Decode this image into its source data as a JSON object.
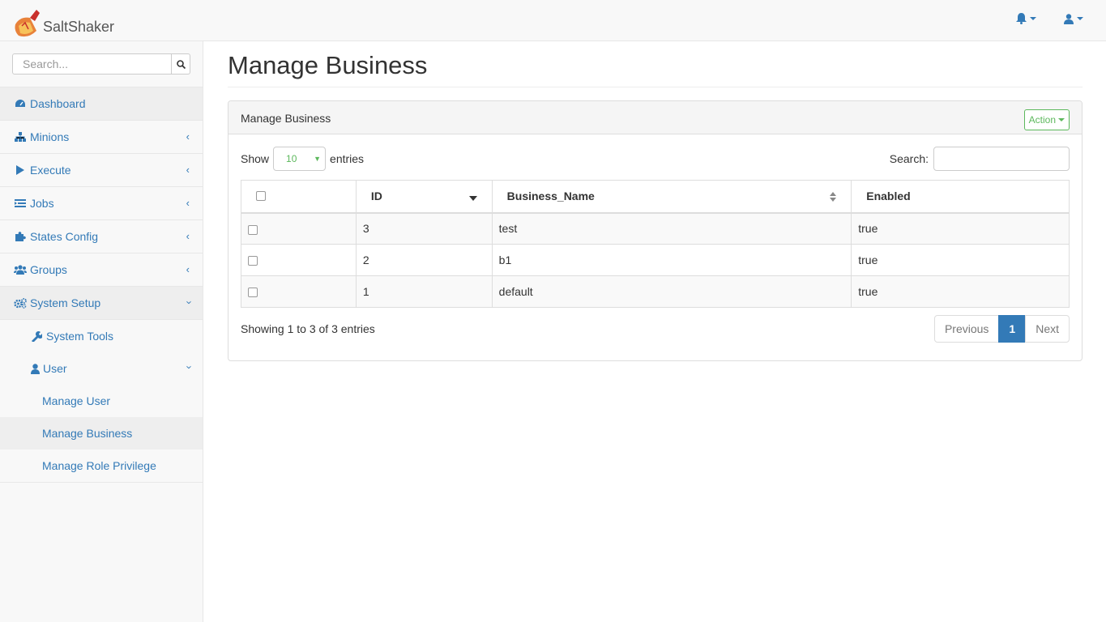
{
  "app": {
    "name": "SaltShaker"
  },
  "navbar": {
    "bell_icon": "bell-icon",
    "user_icon": "user-icon"
  },
  "sidebar": {
    "search_placeholder": "Search...",
    "items": [
      {
        "label": "Dashboard",
        "icon": "dashboard-icon"
      },
      {
        "label": "Minions",
        "icon": "sitemap-icon"
      },
      {
        "label": "Execute",
        "icon": "play-icon"
      },
      {
        "label": "Jobs",
        "icon": "list-icon"
      },
      {
        "label": "States Config",
        "icon": "puzzle-icon"
      },
      {
        "label": "Groups",
        "icon": "users-icon"
      },
      {
        "label": "System Setup",
        "icon": "gears-icon"
      }
    ],
    "system_tools": "System Tools",
    "user": "User",
    "user_children": [
      "Manage User",
      "Manage Business",
      "Manage Role Privilege"
    ]
  },
  "page": {
    "title": "Manage Business"
  },
  "panel": {
    "heading": "Manage Business",
    "action_label": "Action",
    "show_label": "Show",
    "length_value": "10",
    "entries_label": "entries",
    "search_label": "Search:",
    "columns": [
      "",
      "ID",
      "Business_Name",
      "Enabled"
    ],
    "rows": [
      {
        "id": "3",
        "name": "test",
        "enabled": "true"
      },
      {
        "id": "2",
        "name": "b1",
        "enabled": "true"
      },
      {
        "id": "1",
        "name": "default",
        "enabled": "true"
      }
    ],
    "info": "Showing 1 to 3 of 3 entries",
    "pagination": {
      "previous": "Previous",
      "current": "1",
      "next": "Next"
    }
  },
  "colors": {
    "link": "#337ab7",
    "accent_green": "#5cb85c",
    "active_bg": "#eeeeee"
  }
}
